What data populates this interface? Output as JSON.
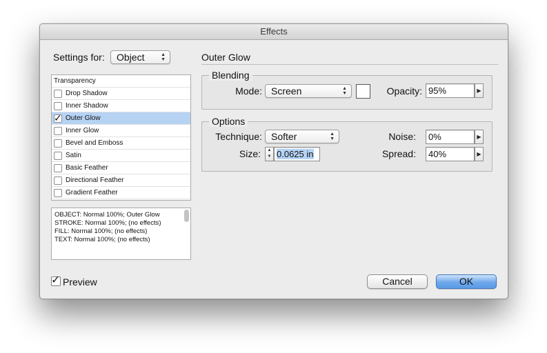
{
  "window": {
    "title": "Effects"
  },
  "settings_for": {
    "label": "Settings for:",
    "value": "Object"
  },
  "effects_list": {
    "header": "Transparency",
    "items": [
      {
        "label": "Drop Shadow",
        "checked": false,
        "selected": false
      },
      {
        "label": "Inner Shadow",
        "checked": false,
        "selected": false
      },
      {
        "label": "Outer Glow",
        "checked": true,
        "selected": true
      },
      {
        "label": "Inner Glow",
        "checked": false,
        "selected": false
      },
      {
        "label": "Bevel and Emboss",
        "checked": false,
        "selected": false
      },
      {
        "label": "Satin",
        "checked": false,
        "selected": false
      },
      {
        "label": "Basic Feather",
        "checked": false,
        "selected": false
      },
      {
        "label": "Directional Feather",
        "checked": false,
        "selected": false
      },
      {
        "label": "Gradient Feather",
        "checked": false,
        "selected": false
      }
    ]
  },
  "summary": {
    "lines": [
      "OBJECT: Normal 100%; Outer Glow",
      "STROKE: Normal 100%; (no effects)",
      "FILL: Normal 100%; (no effects)",
      "TEXT: Normal 100%; (no effects)"
    ]
  },
  "panel": {
    "title": "Outer Glow"
  },
  "blending": {
    "title": "Blending",
    "mode_label": "Mode:",
    "mode_value": "Screen",
    "swatch_color": "#ffffff",
    "opacity_label": "Opacity:",
    "opacity_value": "95%"
  },
  "options": {
    "title": "Options",
    "technique_label": "Technique:",
    "technique_value": "Softer",
    "noise_label": "Noise:",
    "noise_value": "0%",
    "size_label": "Size:",
    "size_value": "0.0625 in",
    "spread_label": "Spread:",
    "spread_value": "40%"
  },
  "preview": {
    "label": "Preview",
    "checked": true
  },
  "buttons": {
    "cancel": "Cancel",
    "ok": "OK"
  },
  "colors": {
    "selection": "#b7d3f3",
    "default_button": "#6fa8ea"
  }
}
